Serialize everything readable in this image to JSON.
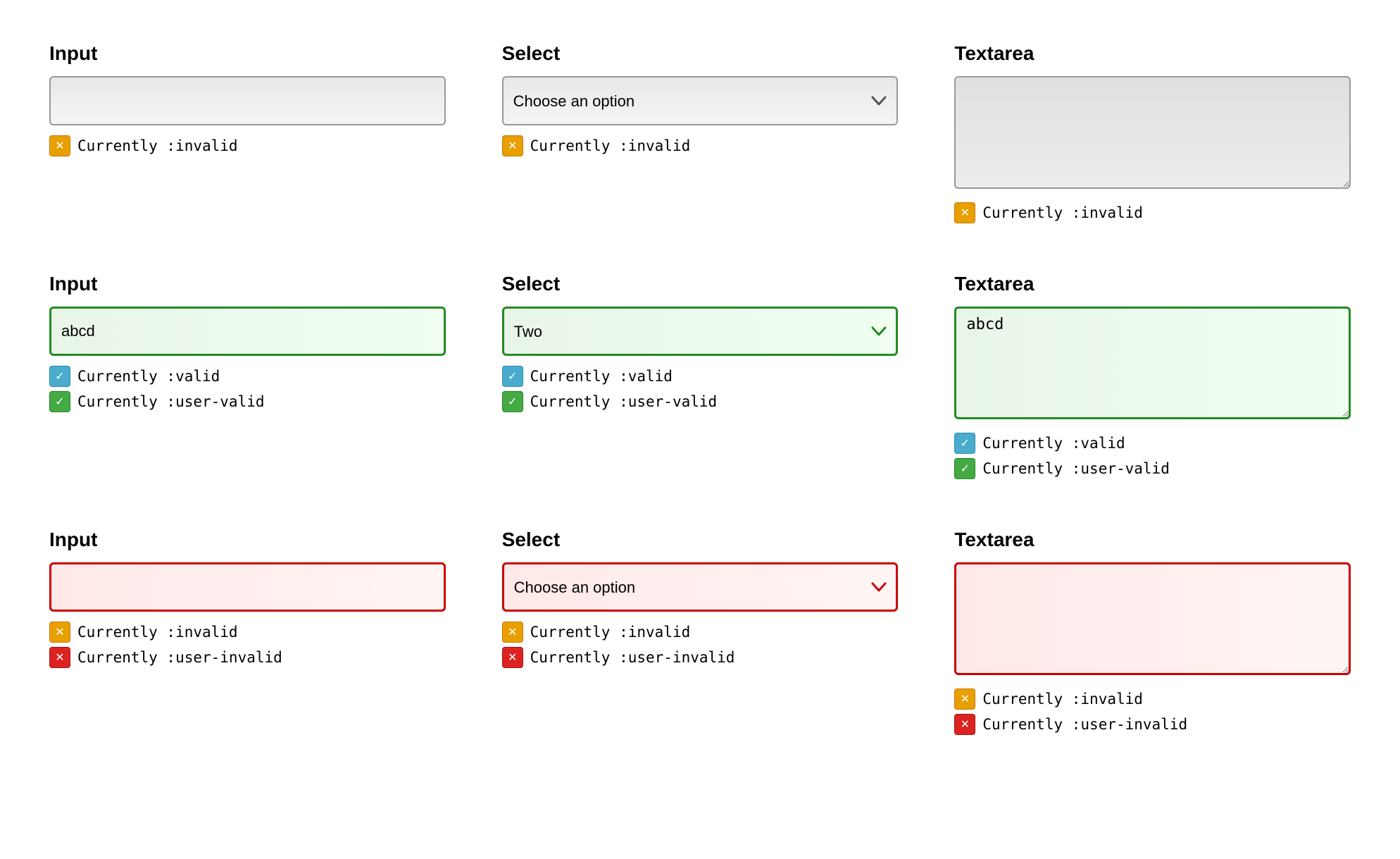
{
  "page": {
    "columns": [
      {
        "id": "default",
        "sections": [
          {
            "type": "input",
            "label": "Input",
            "input_value": "",
            "input_placeholder": "",
            "input_style": "default",
            "statuses": [
              {
                "badge": "orange",
                "text": "Currently ",
                "pseudo": ":invalid"
              }
            ]
          },
          {
            "type": "select",
            "label": "Select",
            "select_value": "",
            "select_placeholder": "Choose an option",
            "select_style": "default",
            "chevron_style": "default",
            "statuses": [
              {
                "badge": "orange",
                "text": "Currently ",
                "pseudo": ":invalid"
              }
            ]
          },
          {
            "type": "textarea",
            "label": "Textarea",
            "textarea_value": "",
            "textarea_style": "default",
            "statuses": [
              {
                "badge": "orange",
                "text": "Currently ",
                "pseudo": ":invalid"
              }
            ]
          }
        ]
      },
      {
        "id": "valid",
        "sections": [
          {
            "type": "input",
            "label": "Input",
            "input_value": "abcd",
            "input_style": "valid",
            "statuses": [
              {
                "badge": "blue",
                "text": "Currently ",
                "pseudo": ":valid"
              },
              {
                "badge": "green",
                "text": "Currently ",
                "pseudo": ":user-valid"
              }
            ]
          },
          {
            "type": "select",
            "label": "Select",
            "select_value": "Two",
            "select_style": "valid",
            "chevron_style": "valid",
            "statuses": [
              {
                "badge": "blue",
                "text": "Currently ",
                "pseudo": ":valid"
              },
              {
                "badge": "green",
                "text": "Currently ",
                "pseudo": ":user-valid"
              }
            ]
          },
          {
            "type": "textarea",
            "label": "Textarea",
            "textarea_value": "abcd",
            "textarea_style": "valid",
            "statuses": [
              {
                "badge": "blue",
                "text": "Currently ",
                "pseudo": ":valid"
              },
              {
                "badge": "green",
                "text": "Currently ",
                "pseudo": ":user-valid"
              }
            ]
          }
        ]
      },
      {
        "id": "user-invalid",
        "sections": [
          {
            "type": "input",
            "label": "Input",
            "input_value": "",
            "input_style": "invalid",
            "statuses": [
              {
                "badge": "orange",
                "text": "Currently ",
                "pseudo": ":invalid"
              },
              {
                "badge": "red",
                "text": "Currently ",
                "pseudo": ":user-invalid"
              }
            ]
          },
          {
            "type": "select",
            "label": "Select",
            "select_value": "",
            "select_placeholder": "Choose an option",
            "select_style": "invalid",
            "chevron_style": "invalid",
            "statuses": [
              {
                "badge": "orange",
                "text": "Currently ",
                "pseudo": ":invalid"
              },
              {
                "badge": "red",
                "text": "Currently ",
                "pseudo": ":user-invalid"
              }
            ]
          },
          {
            "type": "textarea",
            "label": "Textarea",
            "textarea_value": "",
            "textarea_style": "invalid",
            "statuses": [
              {
                "badge": "orange",
                "text": "Currently ",
                "pseudo": ":invalid"
              },
              {
                "badge": "red",
                "text": "Currently ",
                "pseudo": ":user-invalid"
              }
            ]
          }
        ]
      }
    ],
    "badge_symbols": {
      "orange": "✕",
      "blue": "✓",
      "green": "✓",
      "red": "✕"
    }
  }
}
